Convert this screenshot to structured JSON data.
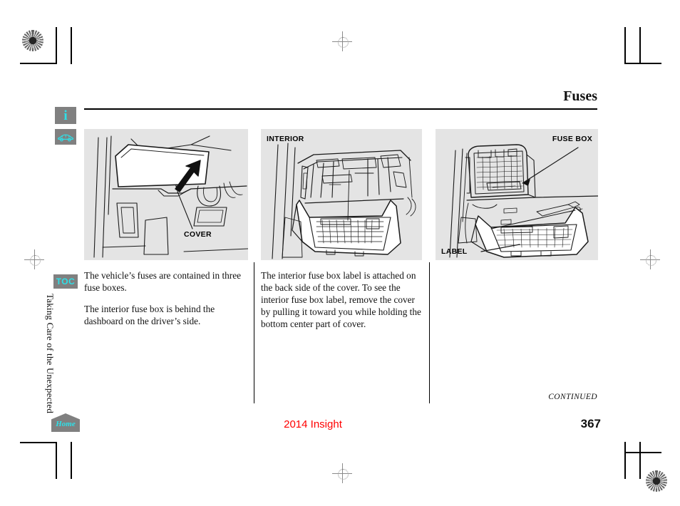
{
  "document": {
    "title": "Fuses",
    "model": "2014 Insight",
    "page_number": "367",
    "continued": "CONTINUED",
    "chapter": "Taking Care of the Unexpected"
  },
  "sidebar": {
    "info_button": "i",
    "car_button": "car-icon",
    "toc_button": "TOC",
    "home_button": "Home"
  },
  "columns": [
    {
      "figure": {
        "name": "fuse-box-cover-illustration",
        "callouts": [
          {
            "text": "COVER",
            "position": "bottom-right"
          }
        ]
      },
      "paragraphs": [
        "The vehicle’s fuses are contained in three fuse boxes.",
        "The interior fuse box is behind the dashboard on the driver’s side."
      ]
    },
    {
      "figure": {
        "name": "interior-fuse-box-illustration",
        "callouts": [
          {
            "text": "INTERIOR",
            "position": "top-left"
          }
        ]
      },
      "paragraphs": [
        "The interior fuse box label is attached on the back side of the cover. To see the interior fuse box label, remove the cover by pulling it toward you while holding the bottom center part of cover."
      ]
    },
    {
      "figure": {
        "name": "fuse-box-label-illustration",
        "callouts": [
          {
            "text": "FUSE BOX",
            "position": "top-right"
          },
          {
            "text": "LABEL",
            "position": "bottom-left"
          }
        ]
      },
      "paragraphs": []
    }
  ],
  "colors": {
    "accent_cyan": "#2ee0e8",
    "model_red": "#ff0000",
    "figure_bg": "#e4e4e4",
    "button_gray": "#808080"
  }
}
